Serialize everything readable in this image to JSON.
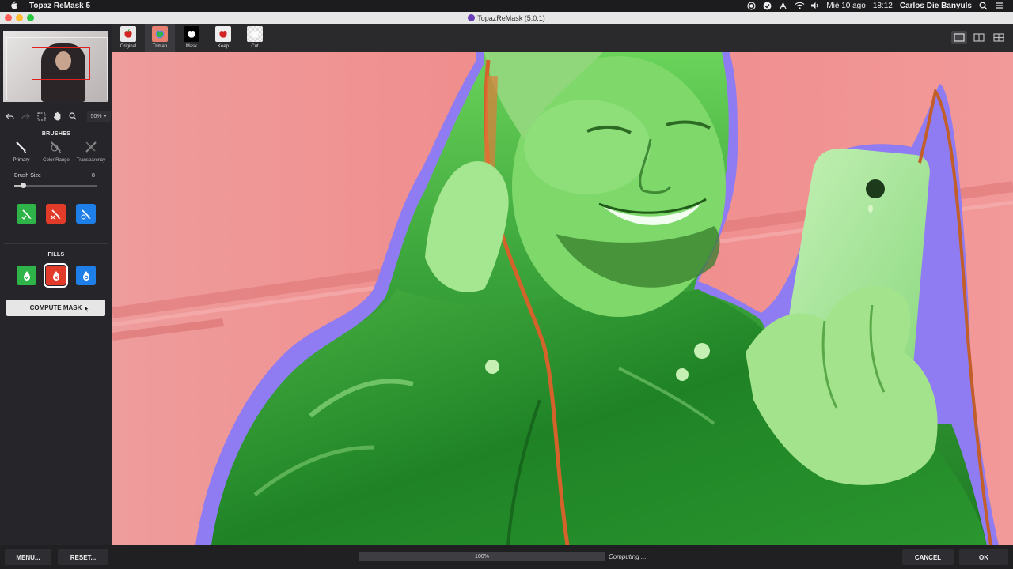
{
  "menubar": {
    "app_name": "Topaz ReMask 5",
    "date": "Mié 10 ago",
    "time": "18:12",
    "user": "Carlos Die Banyuls",
    "icons": [
      "apple-icon",
      "record-icon",
      "update-icon",
      "menu-extra-icon",
      "wifi-icon",
      "sound-icon",
      "search-icon",
      "list-icon"
    ]
  },
  "window": {
    "title": "TopazReMask (5.0.1)"
  },
  "tools": {
    "zoom_level": "50%"
  },
  "brushes": {
    "heading": "BRUSHES",
    "items": [
      {
        "label": "Primary"
      },
      {
        "label": "Color Range"
      },
      {
        "label": "Transparency"
      }
    ],
    "size_label": "Brush Size",
    "size_value": "8",
    "size_fraction": 0.1
  },
  "fills": {
    "heading": "FILLS"
  },
  "compute_label": "COMPUTE MASK",
  "view_modes": [
    {
      "label": "Original"
    },
    {
      "label": "Trimap"
    },
    {
      "label": "Mask"
    },
    {
      "label": "Keep"
    },
    {
      "label": "Cut"
    }
  ],
  "active_view": "Trimap",
  "bottom": {
    "menu_label": "MENU...",
    "reset_label": "RESET...",
    "progress_text": "100%",
    "progress_fraction": 1.0,
    "status_text": "Computing ...",
    "cancel_label": "CANCEL",
    "ok_label": "OK"
  },
  "colors": {
    "keep": "#2fb44a",
    "drop": "#e23b2a",
    "compute": "#1f7fe8",
    "background_overlay": "#f08f8f",
    "edge_overlay": "#8f7cf2"
  }
}
